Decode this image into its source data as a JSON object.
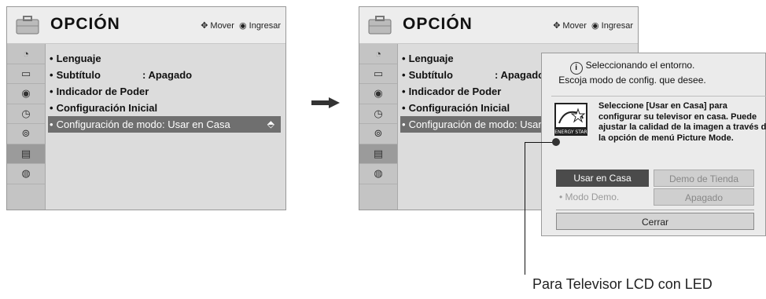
{
  "menu": {
    "title": "OPCIÓN",
    "hint_move": "Mover",
    "hint_enter": "Ingresar",
    "items": [
      {
        "label": "Lenguaje",
        "value": ""
      },
      {
        "label": "Subtítulo",
        "value": ": Apagado"
      },
      {
        "label": "Indicador de Poder",
        "value": ""
      },
      {
        "label": "Configuración Inicial",
        "value": ""
      },
      {
        "label": "Configuración de modo: Usar en Casa",
        "value": ""
      }
    ],
    "items_right_last": "Configuración de modo: Usar en C"
  },
  "sidebar_icons": [
    "picture-icon",
    "screen-icon",
    "audio-icon",
    "clock-icon",
    "lock-icon",
    "option-icon",
    "network-icon"
  ],
  "popup": {
    "message_line1": "Seleccionando el entorno.",
    "message_line2": "Escoja modo de config. que desee.",
    "description": "Seleccione [Usar en Casa] para configurar su televisor en casa. Puede ajustar la calidad de la imagen a través de la opción de menú Picture Mode.",
    "energy_label": "ENERGY STAR",
    "home_button": "Usar en Casa",
    "store_button": "Demo de Tienda",
    "demo_label": "• Modo Demo.",
    "demo_value": "Apagado",
    "close_button": "Cerrar"
  },
  "callout": "Para Televisor LCD con LED"
}
